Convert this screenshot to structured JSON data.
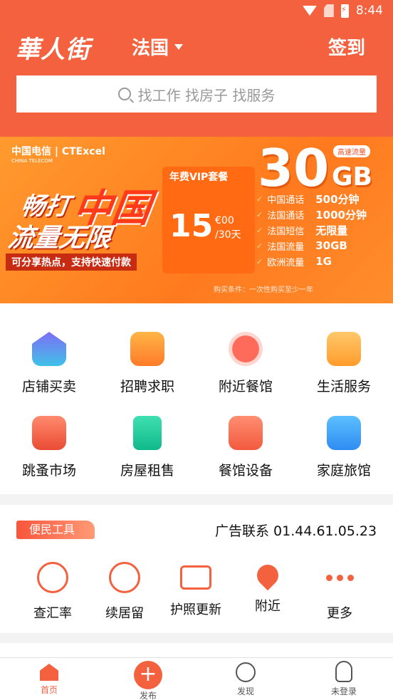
{
  "status_bar": {
    "time": "8:44"
  },
  "header": {
    "logo": "華人街",
    "city": "法国",
    "signin_label": "签到",
    "search_placeholder": "找工作 找房子 找服务"
  },
  "banner": {
    "brand": "中国电信 | CTExcel",
    "brand_sub": "CHINA TELECOM",
    "headline_1": "畅打",
    "headline_big": "中国",
    "headline_2": "流量无限",
    "headline_sub": "可分享热点，支持快速付款",
    "vip_label": "年费VIP套餐",
    "price": "15",
    "price_unit_1": "€00",
    "price_unit_2": "/30天",
    "big_amount": "30",
    "big_unit": "GB",
    "tag": "高速流量",
    "plan": [
      {
        "k": "中国通话",
        "v": "500分钟"
      },
      {
        "k": "法国通话",
        "v": "1000分钟"
      },
      {
        "k": "法国短信",
        "v": "无限量"
      },
      {
        "k": "法国流量",
        "v": "30GB"
      },
      {
        "k": "欧洲流量",
        "v": "1G"
      }
    ],
    "note": "购买条件：一次性购买至少一年"
  },
  "categories": [
    {
      "label": "店铺买卖",
      "icon": "store-icon"
    },
    {
      "label": "招聘求职",
      "icon": "briefcase-icon"
    },
    {
      "label": "附近餐馆",
      "icon": "fork-knife-icon"
    },
    {
      "label": "生活服务",
      "icon": "service-check-icon"
    },
    {
      "label": "跳蚤市场",
      "icon": "shopping-bag-icon"
    },
    {
      "label": "房屋租售",
      "icon": "house-door-icon"
    },
    {
      "label": "餐馆设备",
      "icon": "equipment-star-icon"
    },
    {
      "label": "家庭旅馆",
      "icon": "hotel-building-icon"
    }
  ],
  "tools": {
    "tag": "便民工具",
    "ad": "广告联系 01.44.61.05.23",
    "items": [
      {
        "label": "查汇率",
        "icon": "exchange-rate-icon"
      },
      {
        "label": "续居留",
        "icon": "globe-icon"
      },
      {
        "label": "护照更新",
        "icon": "passport-card-icon"
      },
      {
        "label": "附近",
        "icon": "location-pin-icon"
      },
      {
        "label": "更多",
        "icon": "more-dots-icon"
      }
    ]
  },
  "nav": [
    {
      "label": "首页",
      "icon": "home-icon"
    },
    {
      "label": "发布",
      "icon": "plus-circle-icon"
    },
    {
      "label": "发现",
      "icon": "planet-icon"
    },
    {
      "label": "未登录",
      "icon": "user-icon"
    }
  ],
  "colors": {
    "brand": "#f4613f",
    "banner": "#ff8a24"
  }
}
